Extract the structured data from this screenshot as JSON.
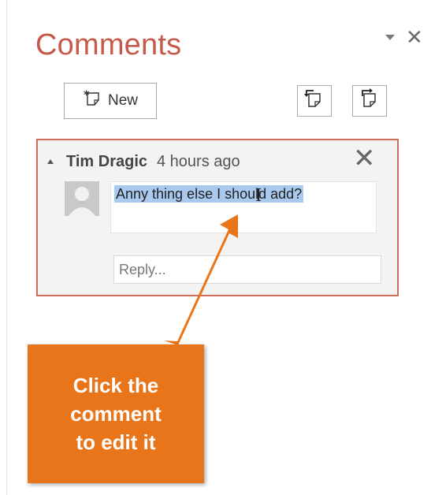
{
  "pane": {
    "title": "Comments",
    "menu_icon": "dropdown-triangle-icon",
    "close_icon": "close-icon",
    "close_symbol": "✕"
  },
  "toolbar": {
    "new_label": "New",
    "new_icon": "new-comment-icon",
    "previous_icon": "previous-comment-icon",
    "next_icon": "next-comment-icon"
  },
  "comment": {
    "author": "Tim Dragic",
    "time": "4 hours ago",
    "text": "Anny thing else I should add?",
    "delete_symbol": "✕",
    "reply_placeholder": "Reply..."
  },
  "callout": {
    "text": "Click the\ncomment\nto edit it"
  },
  "colors": {
    "title": "#c55a4a",
    "card_border": "#cf6c5e",
    "selection": "#a9c9ef",
    "callout": "#e8751a"
  }
}
